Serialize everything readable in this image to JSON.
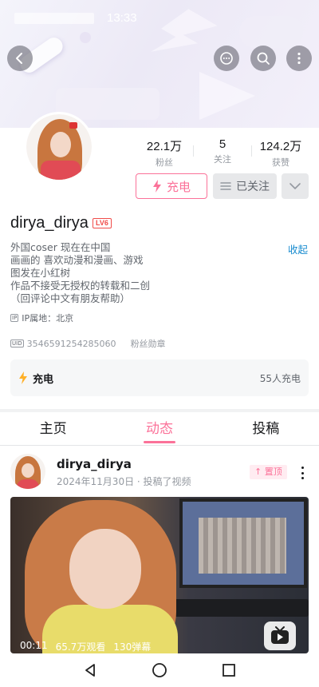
{
  "status": {
    "time": "13:33"
  },
  "header": {
    "back_icon": "back-arrow-icon",
    "actions": [
      "message-icon",
      "search-icon",
      "more-vertical-icon"
    ]
  },
  "profile": {
    "stats": [
      {
        "value": "22.1万",
        "label": "粉丝"
      },
      {
        "value": "5",
        "label": "关注"
      },
      {
        "value": "124.2万",
        "label": "获赞"
      }
    ],
    "charge_label": "充电",
    "follow_label": "已关注",
    "username": "dirya_dirya",
    "level": "LV6",
    "bio_lines": [
      "外国coser  现在在中国",
      "画画的 喜欢动漫和漫画、游戏",
      "图发在小红树",
      "作品不接受无授权的转载和二创",
      "（回评论中文有朋友帮助）"
    ],
    "collapse_label": "收起",
    "ip_tag": "IP",
    "ip_label": "IP属地：北京",
    "uid_tag": "UID",
    "uid": "3546591254285060",
    "medal_label": "粉丝勋章"
  },
  "charge_card": {
    "title": "充电",
    "count": "55人充电"
  },
  "tabs": [
    {
      "label": "主页",
      "active": false
    },
    {
      "label": "动态",
      "active": true
    },
    {
      "label": "投稿",
      "active": false
    }
  ],
  "post": {
    "author": "dirya_dirya",
    "meta": "2024年11月30日 · 投稿了视频",
    "pin_label": "置顶",
    "video": {
      "duration": "00:11",
      "views": "65.7万观看",
      "danmaku": "130弹幕"
    }
  },
  "colors": {
    "accent": "#fb7299",
    "link": "#178bcf",
    "level": "#f04c49",
    "charge_icon": "#ffb027"
  }
}
